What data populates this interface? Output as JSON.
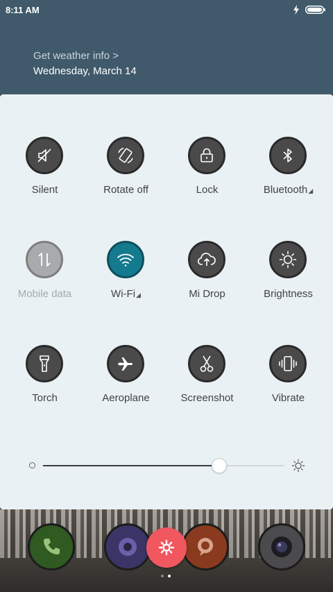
{
  "status": {
    "time": "8:11 AM",
    "icons": [
      "charging-icon",
      "battery-icon"
    ]
  },
  "header": {
    "weather_link": "Get weather info >",
    "date": "Wednesday, March 14"
  },
  "toggles": [
    {
      "label": "Silent",
      "icon": "silent-icon",
      "state": "off"
    },
    {
      "label": "Rotate off",
      "icon": "rotate-icon",
      "state": "off"
    },
    {
      "label": "Lock",
      "icon": "lock-icon",
      "state": "off"
    },
    {
      "label": "Bluetooth",
      "icon": "bluetooth-icon",
      "state": "off",
      "has_menu": true
    },
    {
      "label": "Mobile data",
      "icon": "mobile-data-icon",
      "state": "disabled"
    },
    {
      "label": "Wi-Fi",
      "icon": "wifi-icon",
      "state": "on",
      "has_menu": true
    },
    {
      "label": "Mi Drop",
      "icon": "mi-drop-icon",
      "state": "off"
    },
    {
      "label": "Brightness",
      "icon": "brightness-icon",
      "state": "off"
    },
    {
      "label": "Torch",
      "icon": "torch-icon",
      "state": "off"
    },
    {
      "label": "Aeroplane",
      "icon": "aeroplane-icon",
      "state": "off"
    },
    {
      "label": "Screenshot",
      "icon": "screenshot-icon",
      "state": "off"
    },
    {
      "label": "Vibrate",
      "icon": "vibrate-icon",
      "state": "off"
    }
  ],
  "brightness": {
    "level": 0.73
  },
  "dock": {
    "apps": [
      "phone-icon",
      "browser-icon",
      "messages-icon",
      "camera-icon"
    ],
    "settings_icon": "gear-icon",
    "pages": 2,
    "active_page": 1
  },
  "colors": {
    "header_bg": "#405a6b",
    "panel_bg": "#eaf1f4",
    "toggle_off": "#4a4a4a",
    "toggle_on": "#147a8e",
    "toggle_disabled": "#a9aaab",
    "settings_button": "#f0575f"
  }
}
